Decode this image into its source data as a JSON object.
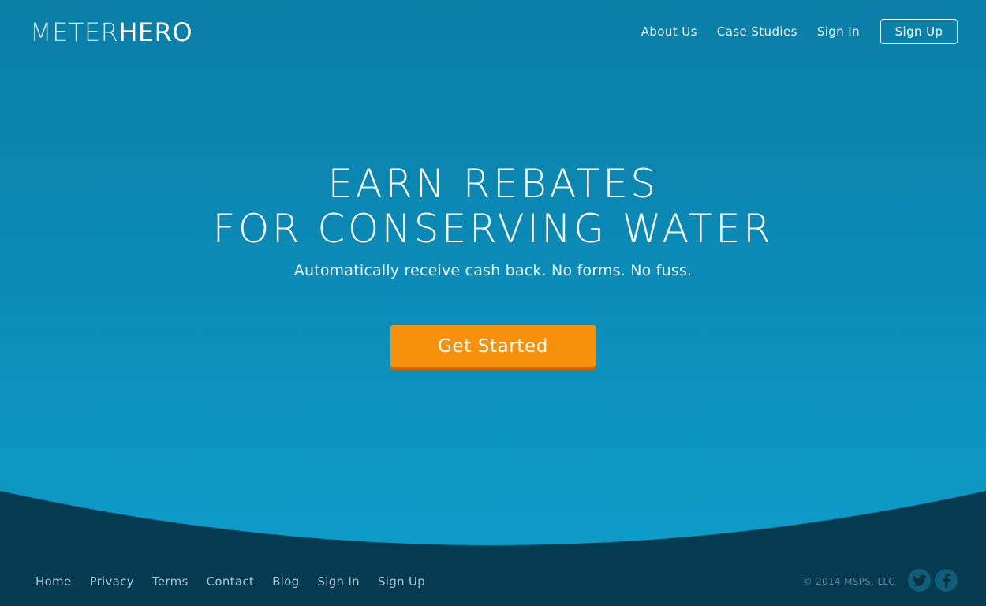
{
  "header": {
    "logo_part1": "METER",
    "logo_part2": "HERO",
    "nav": {
      "about": "About Us",
      "case_studies": "Case Studies",
      "sign_in": "Sign In",
      "sign_up": "Sign Up"
    }
  },
  "hero": {
    "headline_line1": "EARN REBATES",
    "headline_line2": "FOR CONSERVING WATER",
    "subhead": "Automatically receive cash back. No forms. No fuss.",
    "cta_label": "Get Started"
  },
  "footer": {
    "links": {
      "home": "Home",
      "privacy": "Privacy",
      "terms": "Terms",
      "contact": "Contact",
      "blog": "Blog",
      "sign_in": "Sign In",
      "sign_up": "Sign Up"
    },
    "copyright": "© 2014 MSPS, LLC",
    "social": [
      "twitter-icon",
      "facebook-icon"
    ]
  },
  "colors": {
    "accent_orange": "#f7900b",
    "sky_top": "#0a7ea7",
    "sky_bottom": "#0e9fcb",
    "footer_bg": "#043b50"
  }
}
